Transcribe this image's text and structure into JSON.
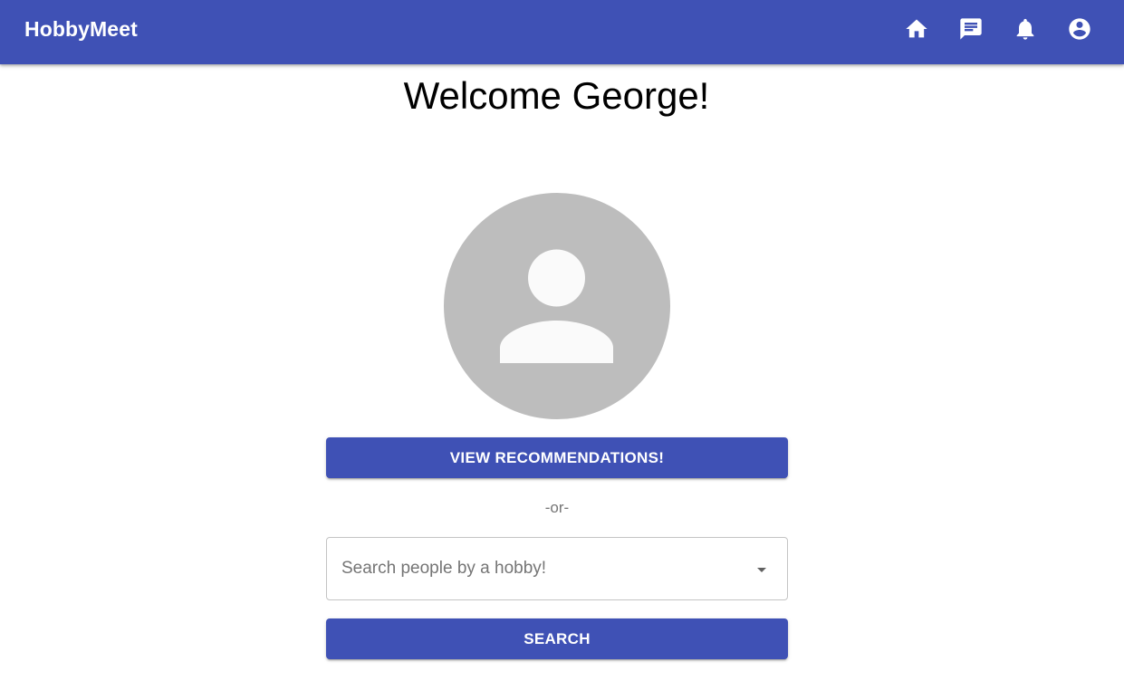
{
  "app": {
    "brand": "HobbyMeet",
    "primary_color": "#3f51b5"
  },
  "nav": {
    "icons": [
      "home-icon",
      "chat-icon",
      "notifications-icon",
      "account-circle-icon"
    ]
  },
  "main": {
    "welcome": "Welcome George!",
    "avatar_icon": "person-icon",
    "recommendations_label": "View Recommendations!",
    "or_text": "-or-",
    "hobby_select": {
      "placeholder": "Search people by a hobby!",
      "value": ""
    },
    "search_label": "Search"
  }
}
